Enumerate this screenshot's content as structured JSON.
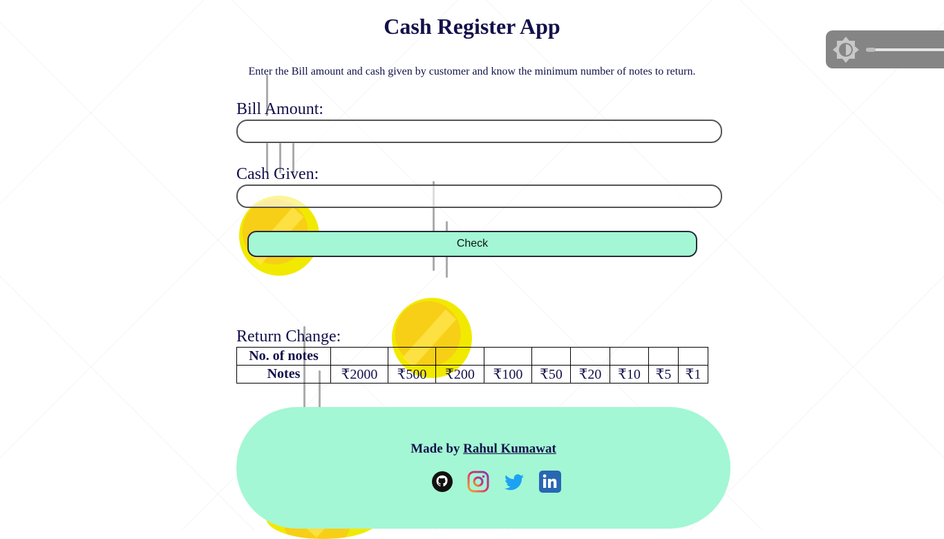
{
  "header": {
    "title": "Cash Register App",
    "subtitle": "Enter the Bill amount and cash given by customer and know the minimum number of notes to return."
  },
  "form": {
    "bill_label": "Bill Amount:",
    "bill_value": "",
    "cash_label": "Cash Given:",
    "cash_value": "",
    "check_label": "Check"
  },
  "result": {
    "label": "Return Change:",
    "rows": [
      {
        "header": "No. of notes",
        "cells": [
          "",
          "",
          "",
          "",
          "",
          "",
          "",
          "",
          ""
        ]
      },
      {
        "header": "Notes",
        "cells": [
          "₹2000",
          "₹500",
          "₹200",
          "₹100",
          "₹50",
          "₹20",
          "₹10",
          "₹5",
          "₹1"
        ]
      }
    ]
  },
  "footer": {
    "made_by_prefix": "Made by",
    "author": "Rahul Kumawat",
    "socials": [
      "github-icon",
      "instagram-icon",
      "twitter-icon",
      "linkedin-icon"
    ]
  },
  "overlay": {
    "brightness_icon": "brightness-icon"
  },
  "colors": {
    "accent": "#a3f7d4",
    "text": "#13114a",
    "coin": "#f7cf16"
  }
}
